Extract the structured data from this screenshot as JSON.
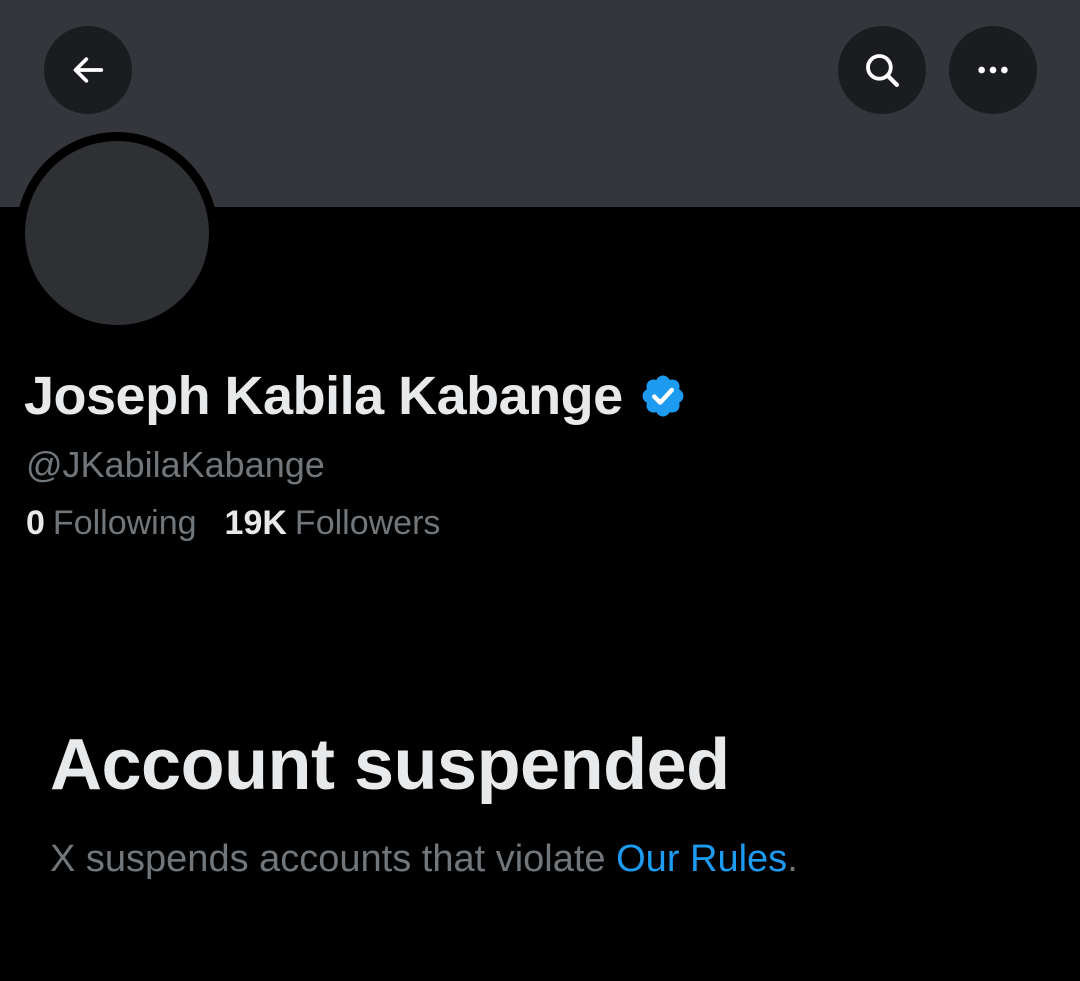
{
  "header": {
    "back_icon": "arrow-left-icon",
    "search_icon": "search-icon",
    "more_icon": "more-horizontal-icon"
  },
  "profile": {
    "display_name": "Joseph Kabila Kabange",
    "verified_icon": "verified-badge-icon",
    "handle": "@JKabilaKabange",
    "following_count": "0",
    "following_label": "Following",
    "followers_count": "19K",
    "followers_label": "Followers"
  },
  "suspension": {
    "title": "Account suspended",
    "description_prefix": "X suspends accounts that violate ",
    "rules_link_text": "Our Rules",
    "description_suffix": "."
  },
  "colors": {
    "background": "#000000",
    "banner": "#34363b",
    "primary_text": "#e7e9ea",
    "secondary_text": "#71767b",
    "link": "#1d9bf0",
    "verified_badge": "#1d9bf0"
  }
}
